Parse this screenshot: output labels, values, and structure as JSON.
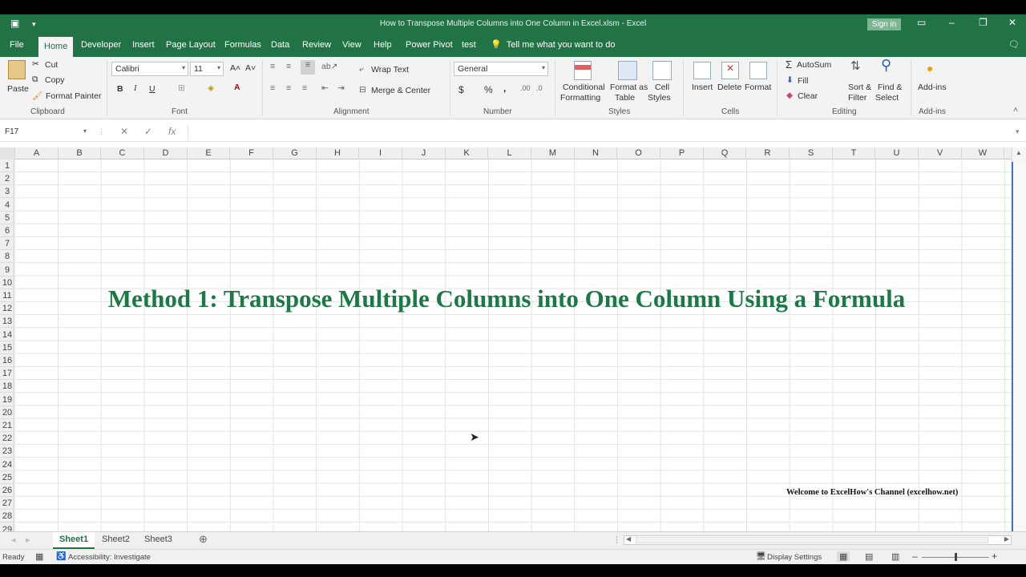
{
  "window": {
    "title": "How to Transpose Multiple Columns into One Column in Excel.xlsm  -  Excel",
    "sign_in": "Sign in"
  },
  "menu_tabs": [
    "File",
    "Home",
    "Developer",
    "Insert",
    "Page Layout",
    "Formulas",
    "Data",
    "Review",
    "View",
    "Help",
    "Power Pivot",
    "test"
  ],
  "active_tab": "Home",
  "tell_me": "Tell me what you want to do",
  "ribbon": {
    "clipboard": {
      "paste": "Paste",
      "cut": "Cut",
      "copy": "Copy",
      "format_painter": "Format Painter",
      "label": "Clipboard"
    },
    "font": {
      "name": "Calibri",
      "size": "11",
      "bold": "B",
      "italic": "I",
      "underline": "U",
      "label": "Font"
    },
    "alignment": {
      "wrap_text": "Wrap Text",
      "merge_center": "Merge & Center",
      "label": "Alignment"
    },
    "number": {
      "format": "General",
      "currency": "$",
      "percent": "%",
      "comma": ",",
      "label": "Number"
    },
    "styles": {
      "conditional1": "Conditional",
      "conditional2": "Formatting",
      "format_table1": "Format as",
      "format_table2": "Table",
      "cell_styles1": "Cell",
      "cell_styles2": "Styles",
      "label": "Styles"
    },
    "cells": {
      "insert": "Insert",
      "delete": "Delete",
      "format": "Format",
      "label": "Cells"
    },
    "editing": {
      "autosum": "AutoSum",
      "fill": "Fill",
      "clear": "Clear",
      "sort1": "Sort &",
      "sort2": "Filter",
      "find1": "Find &",
      "find2": "Select",
      "label": "Editing"
    },
    "addins": {
      "addins": "Add-ins",
      "label": "Add-ins"
    }
  },
  "formula_bar": {
    "name_box": "F17",
    "fx": "fx",
    "value": ""
  },
  "columns": [
    "A",
    "B",
    "C",
    "D",
    "E",
    "F",
    "G",
    "H",
    "I",
    "J",
    "K",
    "L",
    "M",
    "N",
    "O",
    "P",
    "Q",
    "R",
    "S",
    "T",
    "U",
    "V",
    "W"
  ],
  "rows": [
    "1",
    "2",
    "3",
    "4",
    "5",
    "6",
    "7",
    "8",
    "9",
    "10",
    "11",
    "12",
    "13",
    "14",
    "15",
    "16",
    "17",
    "18",
    "19",
    "20",
    "21",
    "22",
    "23",
    "24",
    "25",
    "26",
    "27",
    "28",
    "29"
  ],
  "sheet_content": {
    "title": "Method 1: Transpose Multiple Columns into One Column Using a Formula",
    "welcome": "Welcome to ExcelHow's  Channel (excelhow.net)"
  },
  "sheets": [
    "Sheet1",
    "Sheet2",
    "Sheet3"
  ],
  "active_sheet": "Sheet1",
  "status": {
    "ready": "Ready",
    "accessibility": "Accessibility: Investigate",
    "display_settings": "Display Settings"
  },
  "colors": {
    "accent": "#217346",
    "title_green": "#1a7a46"
  }
}
